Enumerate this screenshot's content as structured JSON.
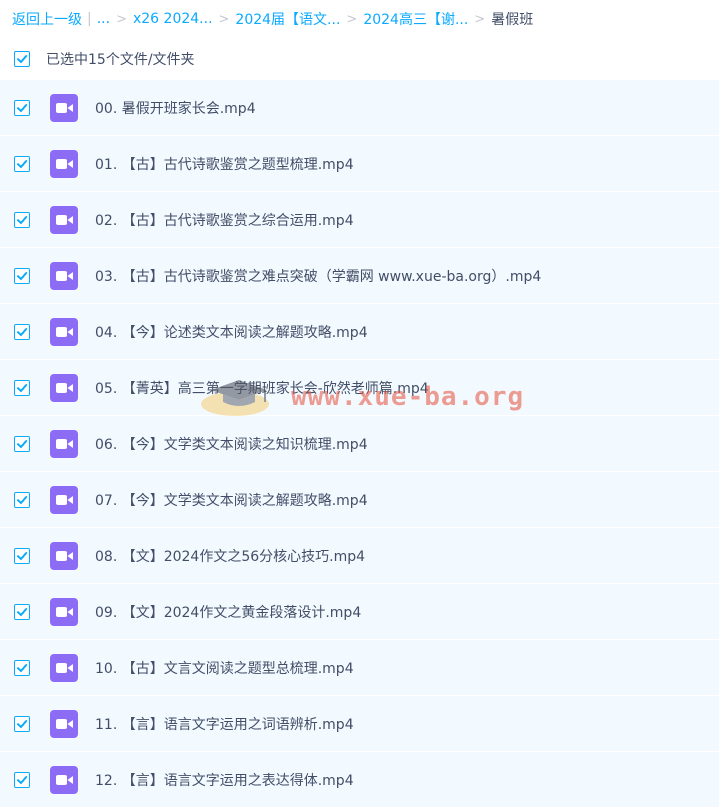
{
  "breadcrumb": {
    "back": "返回上一级",
    "pipe": "|",
    "ellipsis": "...",
    "sep": ">",
    "crumbs": [
      "x26 2024...",
      "2024届【语文...",
      "2024高三【谢..."
    ],
    "current": "暑假班"
  },
  "selection": {
    "label": "已选中15个文件/文件夹",
    "checked": true
  },
  "files": [
    {
      "name": "00. 暑假开班家长会.mp4",
      "checked": true
    },
    {
      "name": "01. 【古】古代诗歌鉴赏之题型梳理.mp4",
      "checked": true
    },
    {
      "name": "02. 【古】古代诗歌鉴赏之综合运用.mp4",
      "checked": true
    },
    {
      "name": "03. 【古】古代诗歌鉴赏之难点突破（学霸网 www.xue-ba.org）.mp4",
      "checked": true
    },
    {
      "name": "04. 【今】论述类文本阅读之解题攻略.mp4",
      "checked": true
    },
    {
      "name": "05. 【菁英】高三第一学期班家长会-欣然老师篇.mp4",
      "checked": true
    },
    {
      "name": "06. 【今】文学类文本阅读之知识梳理.mp4",
      "checked": true
    },
    {
      "name": "07. 【今】文学类文本阅读之解题攻略.mp4",
      "checked": true
    },
    {
      "name": "08. 【文】2024作文之56分核心技巧.mp4",
      "checked": true
    },
    {
      "name": "09. 【文】2024作文之黄金段落设计.mp4",
      "checked": true
    },
    {
      "name": "10. 【古】文言文阅读之题型总梳理.mp4",
      "checked": true
    },
    {
      "name": "11. 【言】语言文字运用之词语辨析.mp4",
      "checked": true
    },
    {
      "name": "12. 【言】语言文字运用之表达得体.mp4",
      "checked": true
    }
  ],
  "watermark": {
    "text": "www.xue-ba.org"
  },
  "colors": {
    "accent": "#09aaff",
    "row_bg": "#f2f9ff",
    "video_icon": "#8c6bf5",
    "text": "#424e67"
  },
  "icons": {
    "checkbox": "checkbox-checked-icon",
    "file": "video-file-icon"
  }
}
